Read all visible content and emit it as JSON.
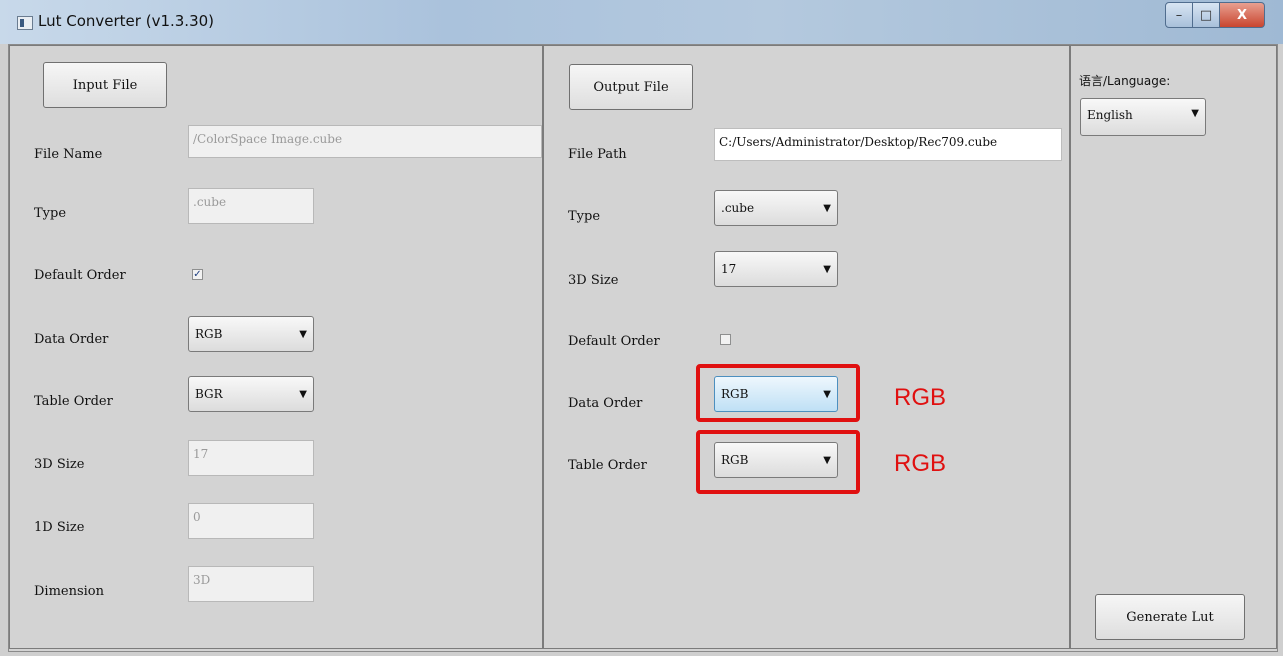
{
  "window": {
    "title": "Lut Converter (v1.3.30)",
    "minimize": "–",
    "maximize": "□",
    "close": "X"
  },
  "input": {
    "button": "Input File",
    "file_name_label": "File Name",
    "file_name_value": "/ColorSpace Image.cube",
    "type_label": "Type",
    "type_value": ".cube",
    "default_order_label": "Default Order",
    "default_order_checked": true,
    "data_order_label": "Data Order",
    "data_order_value": "RGB",
    "table_order_label": "Table Order",
    "table_order_value": "BGR",
    "size3d_label": "3D Size",
    "size3d_value": "17",
    "size1d_label": "1D Size",
    "size1d_value": "0",
    "dimension_label": "Dimension",
    "dimension_value": "3D"
  },
  "output": {
    "button": "Output File",
    "file_path_label": "File Path",
    "file_path_value": "C:/Users/Administrator/Desktop/Rec709.cube",
    "type_label": "Type",
    "type_value": ".cube",
    "size3d_label": "3D Size",
    "size3d_value": "17",
    "default_order_label": "Default Order",
    "default_order_checked": false,
    "data_order_label": "Data Order",
    "data_order_value": "RGB",
    "table_order_label": "Table Order",
    "table_order_value": "RGB"
  },
  "annotations": {
    "data_order_note": "RGB",
    "table_order_note": "RGB",
    "color": "#e01010"
  },
  "language": {
    "label": "语言/Language:",
    "value": "English"
  },
  "generate_button": "Generate Lut"
}
